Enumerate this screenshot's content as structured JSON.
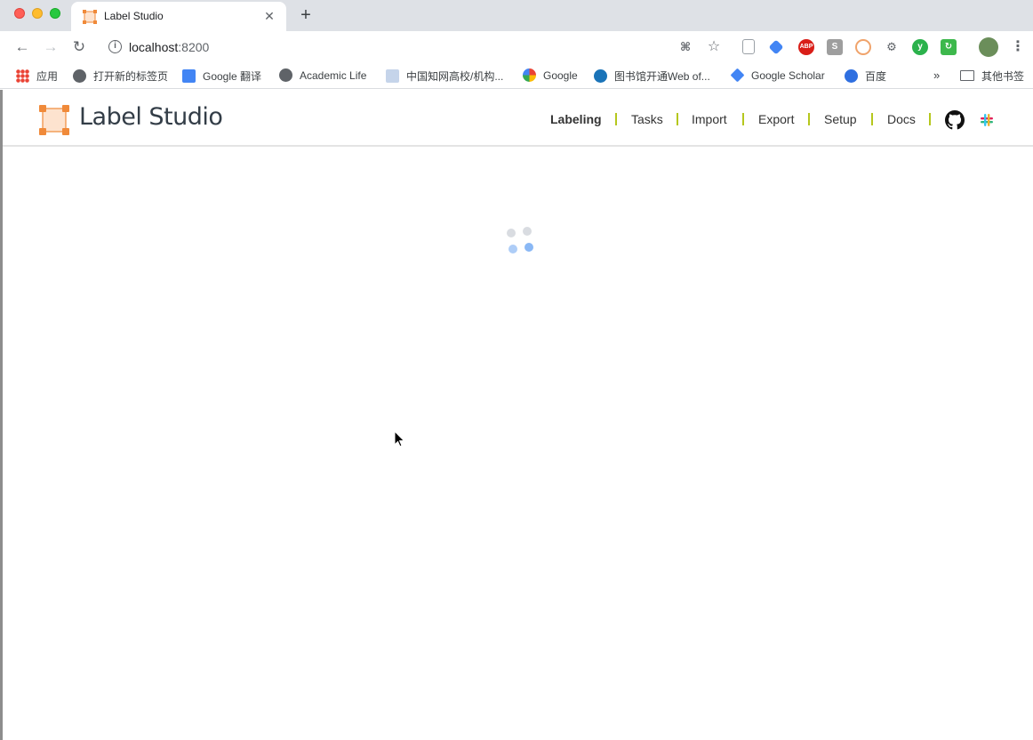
{
  "browser": {
    "tab": {
      "title": "Label Studio"
    },
    "url": {
      "host": "localhost",
      "port": ":8200"
    },
    "bookmarks": [
      {
        "label": "应用",
        "icon": "apps-grid-icon"
      },
      {
        "label": "打开新的标签页",
        "icon": "globe-icon"
      },
      {
        "label": "Google 翻译",
        "icon": "google-translate-icon"
      },
      {
        "label": "Academic Life",
        "icon": "globe-icon"
      },
      {
        "label": "中国知网高校/机构...",
        "icon": "cnki-icon"
      },
      {
        "label": "Google",
        "icon": "google-icon"
      },
      {
        "label": "图书馆开通Web of...",
        "icon": "edge-icon"
      },
      {
        "label": "Google Scholar",
        "icon": "scholar-icon"
      },
      {
        "label": "百度",
        "icon": "baidu-icon"
      },
      {
        "label": "»",
        "icon": ""
      },
      {
        "label": "其他书签",
        "icon": "folder-icon"
      }
    ]
  },
  "app": {
    "logo_text": "Label Studio",
    "menu": [
      {
        "label": "Labeling",
        "active": true
      },
      {
        "label": "Tasks",
        "active": false
      },
      {
        "label": "Import",
        "active": false
      },
      {
        "label": "Export",
        "active": false
      },
      {
        "label": "Setup",
        "active": false
      },
      {
        "label": "Docs",
        "active": false
      }
    ],
    "colors": {
      "logo_orange": "#f08a3a",
      "separator": "#b5c71d",
      "spinner_grey": "#d9dce1",
      "spinner_blue": "#8ab8f5"
    }
  }
}
